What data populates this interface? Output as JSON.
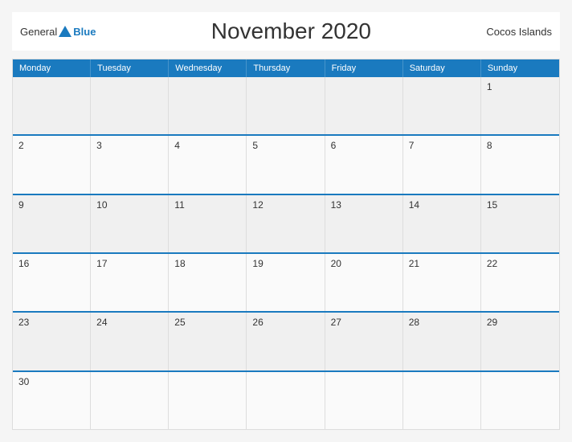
{
  "header": {
    "logo": {
      "general": "General",
      "triangle": "",
      "blue": "Blue"
    },
    "title": "November 2020",
    "location": "Cocos Islands"
  },
  "calendar": {
    "days_of_week": [
      "Monday",
      "Tuesday",
      "Wednesday",
      "Thursday",
      "Friday",
      "Saturday",
      "Sunday"
    ],
    "weeks": [
      [
        {
          "day": "",
          "empty": true
        },
        {
          "day": "",
          "empty": true
        },
        {
          "day": "",
          "empty": true
        },
        {
          "day": "",
          "empty": true
        },
        {
          "day": "",
          "empty": true
        },
        {
          "day": "",
          "empty": true
        },
        {
          "day": "1",
          "empty": false
        }
      ],
      [
        {
          "day": "2",
          "empty": false
        },
        {
          "day": "3",
          "empty": false
        },
        {
          "day": "4",
          "empty": false
        },
        {
          "day": "5",
          "empty": false
        },
        {
          "day": "6",
          "empty": false
        },
        {
          "day": "7",
          "empty": false
        },
        {
          "day": "8",
          "empty": false
        }
      ],
      [
        {
          "day": "9",
          "empty": false
        },
        {
          "day": "10",
          "empty": false
        },
        {
          "day": "11",
          "empty": false
        },
        {
          "day": "12",
          "empty": false
        },
        {
          "day": "13",
          "empty": false
        },
        {
          "day": "14",
          "empty": false
        },
        {
          "day": "15",
          "empty": false
        }
      ],
      [
        {
          "day": "16",
          "empty": false
        },
        {
          "day": "17",
          "empty": false
        },
        {
          "day": "18",
          "empty": false
        },
        {
          "day": "19",
          "empty": false
        },
        {
          "day": "20",
          "empty": false
        },
        {
          "day": "21",
          "empty": false
        },
        {
          "day": "22",
          "empty": false
        }
      ],
      [
        {
          "day": "23",
          "empty": false
        },
        {
          "day": "24",
          "empty": false
        },
        {
          "day": "25",
          "empty": false
        },
        {
          "day": "26",
          "empty": false
        },
        {
          "day": "27",
          "empty": false
        },
        {
          "day": "28",
          "empty": false
        },
        {
          "day": "29",
          "empty": false
        }
      ],
      [
        {
          "day": "30",
          "empty": false
        },
        {
          "day": "",
          "empty": true
        },
        {
          "day": "",
          "empty": true
        },
        {
          "day": "",
          "empty": true
        },
        {
          "day": "",
          "empty": true
        },
        {
          "day": "",
          "empty": true
        },
        {
          "day": "",
          "empty": true
        }
      ]
    ]
  }
}
